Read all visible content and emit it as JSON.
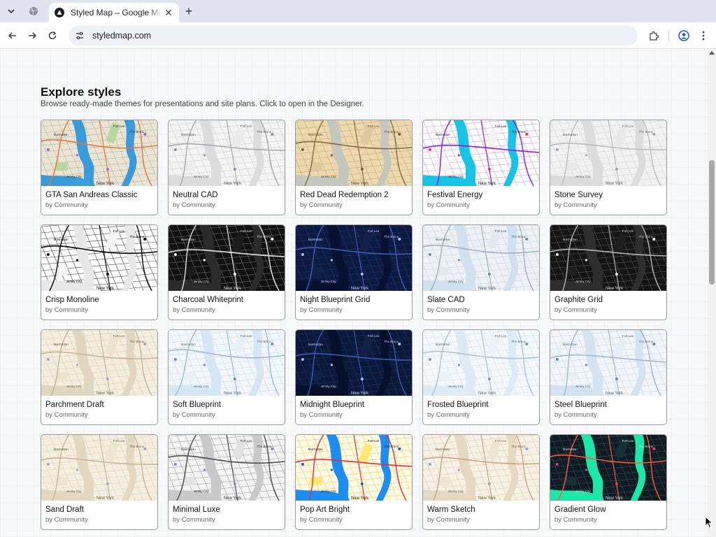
{
  "browser": {
    "tab_title": "Styled Map – Google Maps Style",
    "url": "styledmap.com"
  },
  "page": {
    "title": "Explore styles",
    "subtitle": "Browse ready-made themes for presentations and site plans. Click to open in the Designer."
  },
  "map_labels": {
    "north": "Fort Lee",
    "bronx": "The Bronx",
    "center": "Manhattan",
    "jersey": "Jersey City",
    "ny": "New York"
  },
  "styles": [
    {
      "name": "GTA San Andreas Classic",
      "author": "by Community",
      "theme": {
        "bg": "#e9e4d3",
        "water": "#3a9ad9",
        "road": "#e07a3c",
        "minor": "#b8b4a6",
        "park": "#b5d8a0",
        "accent": "#a55cd8",
        "text": "#333333"
      }
    },
    {
      "name": "Neutral CAD",
      "author": "by Community",
      "theme": {
        "bg": "#f4f4f4",
        "water": "#dcdcdc",
        "road": "#a9a9a9",
        "minor": "#cfcfcf",
        "park": "#ebebeb",
        "accent": "#7d8fb3",
        "text": "#555555"
      }
    },
    {
      "name": "Red Dead Redemption 2",
      "author": "by Community",
      "theme": {
        "bg": "#ecd9b0",
        "water": "#c4c7bd",
        "road": "#8a6a3f",
        "minor": "#c8a877",
        "park": "#dcc9a0",
        "accent": "#7a5c32",
        "text": "#5a4630"
      }
    },
    {
      "name": "Festival Energy",
      "author": "by Community",
      "theme": {
        "bg": "#ffffff",
        "water": "#19c3e3",
        "road": "#8a1dd8",
        "minor": "#c99be8",
        "park": "#f3f3f3",
        "accent": "#ee2d4f",
        "text": "#222222"
      }
    },
    {
      "name": "Stone Survey",
      "author": "by Community",
      "theme": {
        "bg": "#f2f2f2",
        "water": "#dcdcdc",
        "road": "#bdbdbd",
        "minor": "#d5d5d5",
        "park": "#e9e9e9",
        "accent": "#9aa5b8",
        "text": "#666666"
      }
    },
    {
      "name": "Crisp Monoline",
      "author": "by Community",
      "theme": {
        "bg": "#ffffff",
        "water": "#e8e8e8",
        "road": "#000000",
        "minor": "#444444",
        "park": "#f5f5f5",
        "accent": "#000000",
        "text": "#000000"
      }
    },
    {
      "name": "Charcoal Whiteprint",
      "author": "by Community",
      "theme": {
        "bg": "#111111",
        "water": "#2b2b2b",
        "road": "#e6e6e6",
        "minor": "#6a6a6a",
        "park": "#1c1c1c",
        "accent": "#ffffff",
        "text": "#dddddd"
      }
    },
    {
      "name": "Night Blueprint Grid",
      "author": "by Community",
      "theme": {
        "bg": "#0d1a3f",
        "water": "#081230",
        "road": "#3d5fb8",
        "minor": "#1f3670",
        "park": "#13224d",
        "accent": "#a8c2ff",
        "text": "#c9d6ff"
      }
    },
    {
      "name": "Slate CAD",
      "author": "by Community",
      "theme": {
        "bg": "#eef2f6",
        "water": "#cfe0ee",
        "road": "#9fb0c2",
        "minor": "#c9d3de",
        "park": "#e3e9ef",
        "accent": "#6d86a6",
        "text": "#4a5a6e"
      }
    },
    {
      "name": "Graphite Grid",
      "author": "by Community",
      "theme": {
        "bg": "#151515",
        "water": "#2e2e2e",
        "road": "#b5b5b5",
        "minor": "#555555",
        "park": "#1f1f1f",
        "accent": "#eeeeee",
        "text": "#cccccc"
      }
    },
    {
      "name": "Parchment Draft",
      "author": "by Community",
      "theme": {
        "bg": "#f4eee1",
        "water": "#e1d6bf",
        "road": "#c8b38c",
        "minor": "#ddd0b4",
        "park": "#ece3cf",
        "accent": "#8faac8",
        "text": "#6b5a3e"
      }
    },
    {
      "name": "Soft Blueprint",
      "author": "by Community",
      "theme": {
        "bg": "#f3f7fb",
        "water": "#d5e6f5",
        "road": "#9bbbd9",
        "minor": "#c9dbec",
        "park": "#e8f0f8",
        "accent": "#5f8ec2",
        "text": "#4a6a8e"
      }
    },
    {
      "name": "Midnight Blueprint",
      "author": "by Community",
      "theme": {
        "bg": "#0b1838",
        "water": "#07102a",
        "road": "#3a5cb0",
        "minor": "#1d3268",
        "park": "#112148",
        "accent": "#a8c2ff",
        "text": "#c9d6ff"
      }
    },
    {
      "name": "Frosted Blueprint",
      "author": "by Community",
      "theme": {
        "bg": "#f5f9fc",
        "water": "#dcebf6",
        "road": "#a7c4de",
        "minor": "#d0e0ee",
        "park": "#eaf2f8",
        "accent": "#6a97c6",
        "text": "#4a6a8e"
      }
    },
    {
      "name": "Steel Blueprint",
      "author": "by Community",
      "theme": {
        "bg": "#f2f6fa",
        "water": "#d3e3f1",
        "road": "#9dbad6",
        "minor": "#c7d8e8",
        "park": "#e6eef6",
        "accent": "#5a87b8",
        "text": "#4a6a8e"
      }
    },
    {
      "name": "Sand Draft",
      "author": "by Community",
      "theme": {
        "bg": "#f5efe2",
        "water": "#e3d8c0",
        "road": "#cdb68e",
        "minor": "#e0d3b6",
        "park": "#eee5d1",
        "accent": "#91abc8",
        "text": "#6b5a3e"
      }
    },
    {
      "name": "Minimal Luxe",
      "author": "by Community",
      "theme": {
        "bg": "#f4f4f4",
        "water": "#c9c9c9",
        "road": "#4a4a4a",
        "minor": "#a3a3a3",
        "park": "#e2e2e2",
        "accent": "#8f7fd0",
        "text": "#333333"
      }
    },
    {
      "name": "Pop Art Bright",
      "author": "by Community",
      "theme": {
        "bg": "#fffbe8",
        "water": "#1e8df0",
        "road": "#e82b3c",
        "minor": "#f0c64a",
        "park": "#ffe873",
        "accent": "#1658d8",
        "text": "#222222"
      }
    },
    {
      "name": "Warm Sketch",
      "author": "by Community",
      "theme": {
        "bg": "#f7f1e6",
        "water": "#e5d9c4",
        "road": "#caa57e",
        "minor": "#e0cdb2",
        "park": "#efe5d3",
        "accent": "#8da7c4",
        "text": "#6b5a3e"
      }
    },
    {
      "name": "Gradient Glow",
      "author": "by Community",
      "theme": {
        "bg": "#0f1c24",
        "water": "#1ee6a8",
        "road": "#ff5a3c",
        "minor": "#3a4a56",
        "park": "#16303a",
        "accent": "#ff2d7a",
        "text": "#dddddd"
      }
    }
  ]
}
